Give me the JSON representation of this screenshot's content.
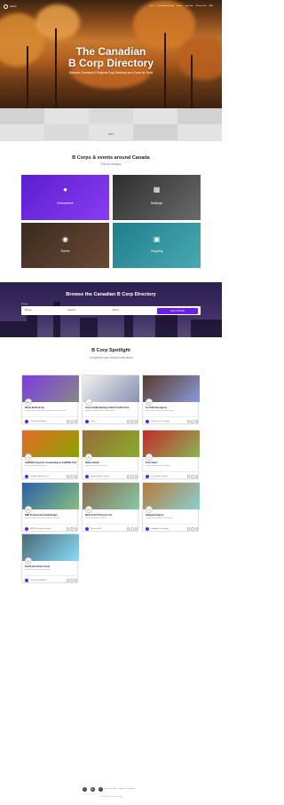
{
  "nav": {
    "logo_text": "Search",
    "links": [
      "About",
      "Canadian Directory",
      "Events",
      "Join Now",
      "BCorp Tools",
      "FAQ"
    ]
  },
  "hero": {
    "title_line1": "The Canadian",
    "title_line2": "B Corp Directory",
    "subtitle_line1": "Discover Canadian & Regional Corp Business as a Force for Good"
  },
  "band": {
    "label": "1010"
  },
  "categories": {
    "title": "B Corps & events around Canada",
    "subtitle": "Find by category",
    "items": [
      {
        "label": "Environment",
        "icon": "location-pin-icon",
        "color": "#6a2dd8"
      },
      {
        "label": "Buildings",
        "icon": "building-icon",
        "color": "#4a4a4a"
      },
      {
        "label": "Events",
        "icon": "event-icon",
        "color": "#443224"
      },
      {
        "label": "Shopping",
        "icon": "shopping-bag-icon",
        "color": "#2b8f9a"
      }
    ]
  },
  "browse": {
    "title": "Browse the Canadian B Corp Directory",
    "badge": "B Corp",
    "fields": [
      "Region",
      "Industry",
      "Search"
    ],
    "button": "Find a B Corp"
  },
  "spotlight": {
    "title": "B Corp Spotlight",
    "subtitle": "Companies you should know about",
    "cards": [
      {
        "title": "Whole Earth Group",
        "desc": "Organic food & sustainable products across Canada",
        "company": "Community Member",
        "img_color": "#7b3be0",
        "avatar": "WEG"
      },
      {
        "title": "Coast Capital Savings Federal Credit Union",
        "desc": "Member-owned financial cooperative",
        "company": "Coast",
        "img_color": "#f0f0f0",
        "avatar": "cc"
      },
      {
        "title": "So Collective Agency",
        "desc": "Social impact consulting and design",
        "company": "Collective Co. Canada",
        "img_color": "#5a3a2a",
        "avatar": "SoC"
      },
      {
        "title": "CHANGE Group for Ltd operating as CHANGE Clothing & Apparel",
        "desc": "Ethical clothing and apparel",
        "company": "Change Clothing & Co.",
        "img_color": "#e56a26",
        "avatar": "CH"
      },
      {
        "title": "Nature Kinder",
        "desc": "Natural play learning for kids",
        "company": "Nature Kinder Canada",
        "img_color": "#9a6a3a",
        "avatar": "NK"
      },
      {
        "title": "Civic Vision",
        "desc": "Digital trust & civic technology",
        "company": "Civic Vision Canada",
        "img_color": "#c42a2a",
        "avatar": "CV"
      },
      {
        "title": "BNR Professional Grade Design",
        "desc": "Professional interior and architectural design",
        "company": "BNR Professional Design",
        "img_color": "#2a5fa8",
        "avatar": "BNR"
      },
      {
        "title": "Bark & Fitz Provisions Ltd",
        "desc": "Natural pet food & supplies",
        "company": "Bark and Fitz",
        "img_color": "#8a6a4a",
        "avatar": "B&F"
      },
      {
        "title": "Valeguard Agency",
        "desc": "Sustainable branding and strategy",
        "company": "Valeguard Consulting",
        "img_color": "#b87a3a",
        "avatar": "VG"
      },
      {
        "title": "Social Investment Group",
        "desc": "Impact investing for communities",
        "company": "Community Builders",
        "img_color": "#4a6a7a",
        "avatar": "SIG"
      }
    ]
  },
  "footer": {
    "links": "Privacy Policy · Terms & Conditions",
    "copyright": "© 2024 The B Corp Group"
  }
}
